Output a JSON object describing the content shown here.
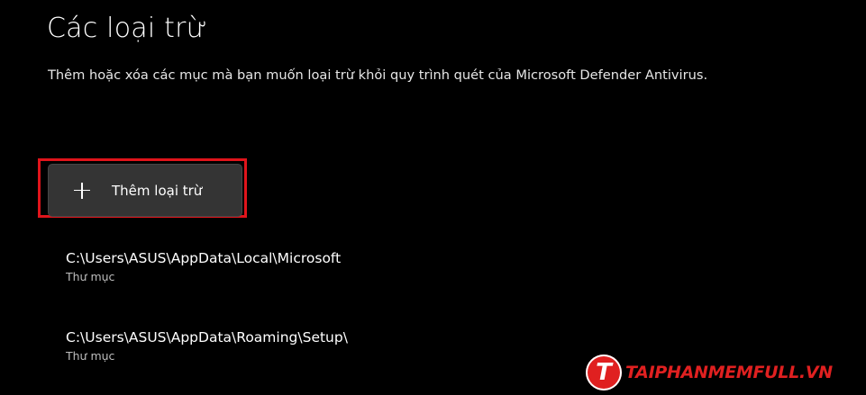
{
  "page": {
    "title": "Các loại trừ",
    "description": "Thêm hoặc xóa các mục mà bạn muốn loại trừ khỏi quy trình quét của Microsoft Defender Antivirus."
  },
  "add_button": {
    "label": "Thêm loại trừ",
    "icon": "plus-icon"
  },
  "highlight_color": "#e0141b",
  "exclusions": [
    {
      "path": "C:\\Users\\ASUS\\AppData\\Local\\Microsoft",
      "type": "Thư mục"
    },
    {
      "path": "C:\\Users\\ASUS\\AppData\\Roaming\\Setup\\",
      "type": "Thư mục"
    }
  ],
  "watermark": {
    "badge": "T",
    "text": "TAIPHANMEMFULL.VN",
    "color": "#e02020"
  }
}
